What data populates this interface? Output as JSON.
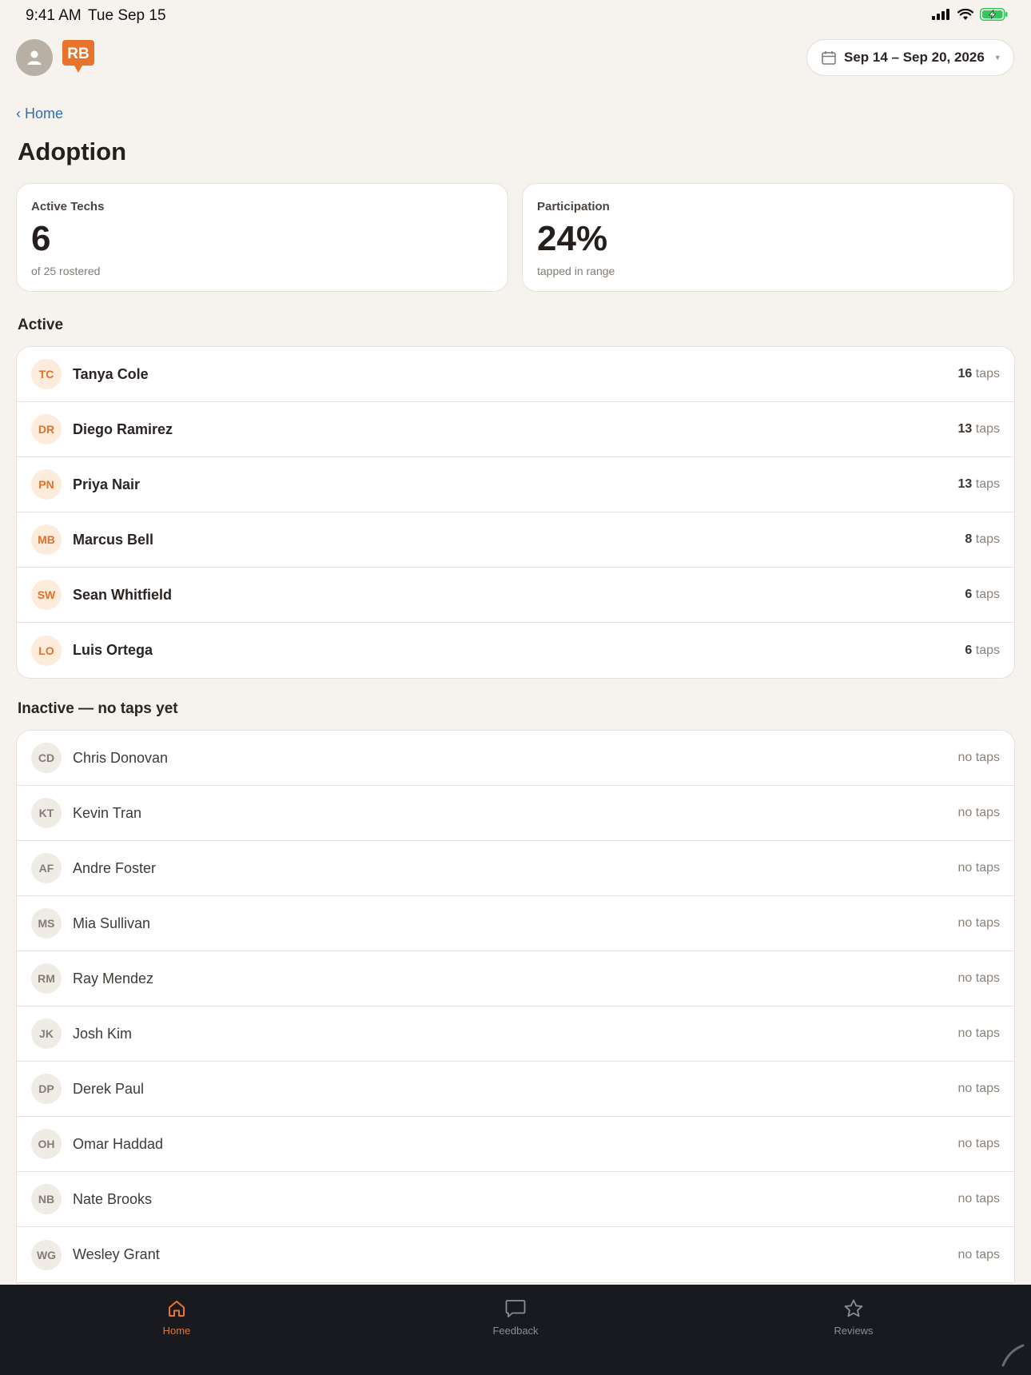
{
  "status_bar": {
    "time": "9:41 AM",
    "date": "Tue Sep 15"
  },
  "header": {
    "logo_text": "RB",
    "date_range": "Sep 14 – Sep 20, 2026"
  },
  "nav": {
    "back_label": "‹ Home"
  },
  "page_title": "Adoption",
  "stats": {
    "active_techs": {
      "label": "Active Techs",
      "value": "6",
      "sub": "of 25 rostered"
    },
    "participation": {
      "label": "Participation",
      "value": "24%",
      "sub": "tapped in range"
    }
  },
  "active_section": {
    "title": "Active",
    "unit": "taps",
    "rows": [
      {
        "initials": "TC",
        "name": "Tanya Cole",
        "count": "16"
      },
      {
        "initials": "DR",
        "name": "Diego Ramirez",
        "count": "13"
      },
      {
        "initials": "PN",
        "name": "Priya Nair",
        "count": "13"
      },
      {
        "initials": "MB",
        "name": "Marcus Bell",
        "count": "8"
      },
      {
        "initials": "SW",
        "name": "Sean Whitfield",
        "count": "6"
      },
      {
        "initials": "LO",
        "name": "Luis Ortega",
        "count": "6"
      }
    ]
  },
  "inactive_section": {
    "title": "Inactive — no taps yet",
    "status": "no taps",
    "rows": [
      {
        "initials": "CD",
        "name": "Chris Donovan"
      },
      {
        "initials": "KT",
        "name": "Kevin Tran"
      },
      {
        "initials": "AF",
        "name": "Andre Foster"
      },
      {
        "initials": "MS",
        "name": "Mia Sullivan"
      },
      {
        "initials": "RM",
        "name": "Ray Mendez"
      },
      {
        "initials": "JK",
        "name": "Josh Kim"
      },
      {
        "initials": "DP",
        "name": "Derek Paul"
      },
      {
        "initials": "OH",
        "name": "Omar Haddad"
      },
      {
        "initials": "NB",
        "name": "Nate Brooks"
      },
      {
        "initials": "WG",
        "name": "Wesley Grant"
      }
    ]
  },
  "tab_bar": {
    "tabs": [
      {
        "label": "Home",
        "icon": "home-icon",
        "active": true
      },
      {
        "label": "Feedback",
        "icon": "chat-bubble-icon",
        "active": false
      },
      {
        "label": "Reviews",
        "icon": "star-icon",
        "active": false
      }
    ]
  },
  "colors": {
    "accent": "#e8742c",
    "link": "#2f6fb3",
    "background": "#f6f3ef",
    "tab_bar": "#191a1f",
    "battery": "#34c759"
  }
}
